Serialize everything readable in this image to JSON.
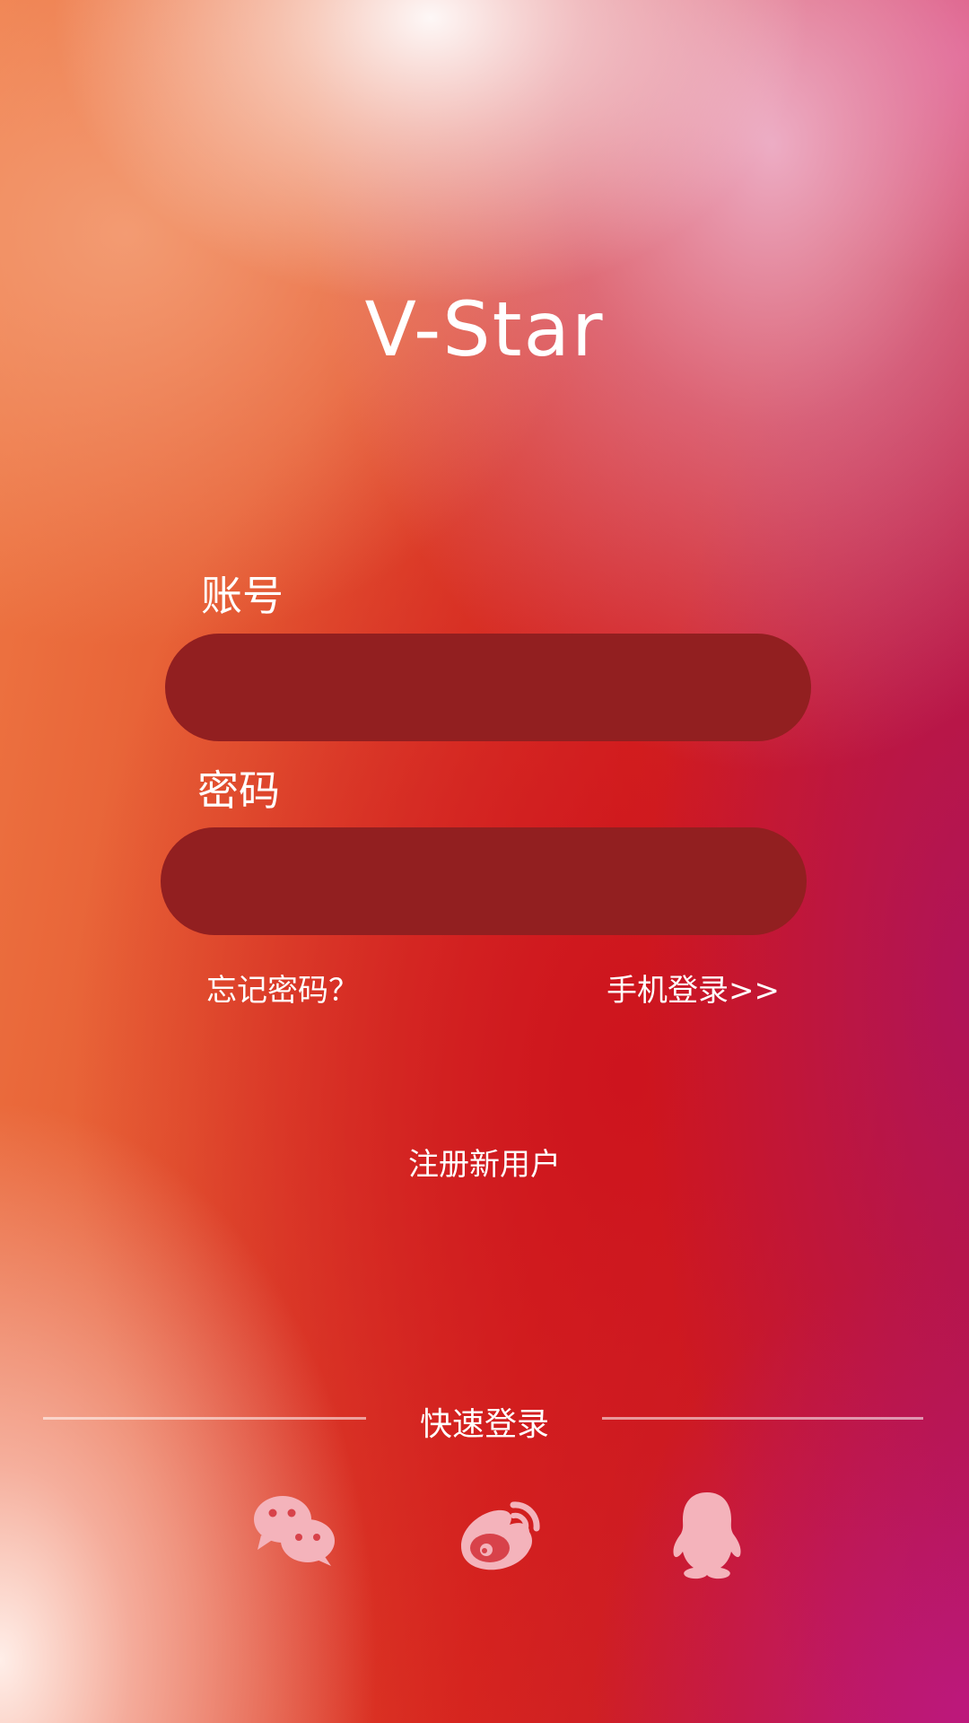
{
  "app": {
    "title": "V-Star"
  },
  "form": {
    "account_label": "账号",
    "account_value": "",
    "account_placeholder": "",
    "password_label": "密码",
    "password_value": "",
    "password_placeholder": ""
  },
  "links": {
    "forgot_password": "忘记密码？",
    "phone_login": "手机登录>>",
    "register": "注册新用户"
  },
  "quick_login": {
    "label": "快速登录",
    "icons": [
      "wechat-icon",
      "weibo-icon",
      "qq-icon"
    ]
  },
  "colors": {
    "input_background": "#921f20",
    "icon_color": "#f4b3bb",
    "text": "#ffffff"
  }
}
